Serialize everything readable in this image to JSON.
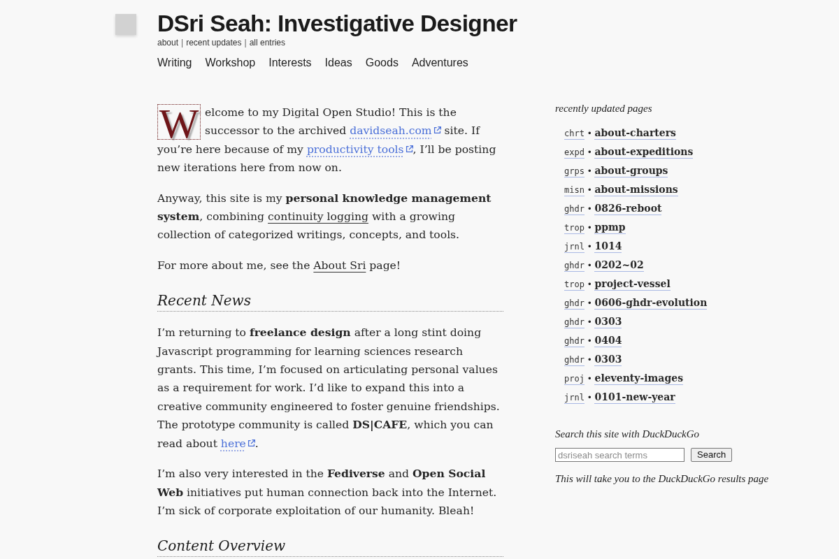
{
  "site": {
    "title": "DSri Seah: Investigative Designer",
    "subnav": [
      {
        "kind": "link",
        "text": "about"
      },
      {
        "kind": "separator",
        "text": "|"
      },
      {
        "kind": "link",
        "text": "recent updates"
      },
      {
        "kind": "separator",
        "text": "|"
      },
      {
        "kind": "link",
        "text": "all entries"
      }
    ],
    "nav": [
      "Writing",
      "Workshop",
      "Interests",
      "Ideas",
      "Goods",
      "Adventures"
    ]
  },
  "main": {
    "blocks": [
      {
        "kind": "paragraph",
        "drop_cap": "W",
        "segments": [
          {
            "kind": "text",
            "text": "elcome to my Digital Open Studio! This is the successor to the archived "
          },
          {
            "kind": "external_link",
            "text": "davidseah.com"
          },
          {
            "kind": "text",
            "text": " site. If you’re here because of my "
          },
          {
            "kind": "external_link",
            "text": "productivity tools"
          },
          {
            "kind": "text",
            "text": ", I’ll be posting new iterations here from now on."
          }
        ]
      },
      {
        "kind": "paragraph",
        "segments": [
          {
            "kind": "text",
            "text": "Anyway, this site is my **personal knowledge management system**, combining "
          },
          {
            "kind": "link",
            "text": "continuity logging"
          },
          {
            "kind": "text",
            "text": " with a growing collection of categorized writings, concepts, and tools."
          }
        ]
      },
      {
        "kind": "paragraph",
        "segments": [
          {
            "kind": "text",
            "text": "For more about me, see the "
          },
          {
            "kind": "link",
            "text": "About Sri"
          },
          {
            "kind": "text",
            "text": " page!"
          }
        ]
      },
      {
        "kind": "heading",
        "text": "Recent News"
      },
      {
        "kind": "paragraph",
        "segments": [
          {
            "kind": "text",
            "text": "I’m returning to **freelance design** after a long stint doing Javascript programming for learning sciences research grants. This time, I’m focused on articulating personal values as a requirement for work. I’d like to expand this into a creative community engineered to foster genuine friendships. The prototype community is called **DS|CAFE**, which you can read about "
          },
          {
            "kind": "external_link",
            "text": "here"
          },
          {
            "kind": "text",
            "text": "."
          }
        ]
      },
      {
        "kind": "paragraph",
        "segments": [
          {
            "kind": "text",
            "text": "I’m also very interested in the **Fediverse** and **Open Social Web** initiatives put human connection back into the Internet. I’m sick of corporate exploitation of our humanity. Bleah!"
          }
        ]
      },
      {
        "kind": "heading",
        "text": "Content Overview"
      }
    ]
  },
  "sidebar": {
    "recent": {
      "title": "recently updated pages",
      "items": [
        {
          "tag": "chrt",
          "bullet": "•",
          "page": "about-charters"
        },
        {
          "tag": "expd",
          "bullet": "•",
          "page": "about-expeditions"
        },
        {
          "tag": "grps",
          "bullet": "•",
          "page": "about-groups"
        },
        {
          "tag": "misn",
          "bullet": "•",
          "page": "about-missions"
        },
        {
          "tag": "ghdr",
          "bullet": "•",
          "page": "0826-reboot"
        },
        {
          "tag": "trop",
          "bullet": "•",
          "page": "ppmp"
        },
        {
          "tag": "jrnl",
          "bullet": "•",
          "page": "1014"
        },
        {
          "tag": "ghdr",
          "bullet": "•",
          "page": "0202~02"
        },
        {
          "tag": "trop",
          "bullet": "•",
          "page": "project-vessel"
        },
        {
          "tag": "ghdr",
          "bullet": "•",
          "page": "0606-ghdr-evolution"
        },
        {
          "tag": "ghdr",
          "bullet": "•",
          "page": "0303"
        },
        {
          "tag": "ghdr",
          "bullet": "•",
          "page": "0404"
        },
        {
          "tag": "ghdr",
          "bullet": "•",
          "page": "0303"
        },
        {
          "tag": "proj",
          "bullet": "•",
          "page": "eleventy-images"
        },
        {
          "tag": "jrnl",
          "bullet": "•",
          "page": "0101-new-year"
        }
      ]
    },
    "search": {
      "label": "Search this site with DuckDuckGo",
      "placeholder": "dsriseah search terms",
      "button": "Search",
      "note": "This will take you to the DuckDuckGo results page"
    }
  }
}
